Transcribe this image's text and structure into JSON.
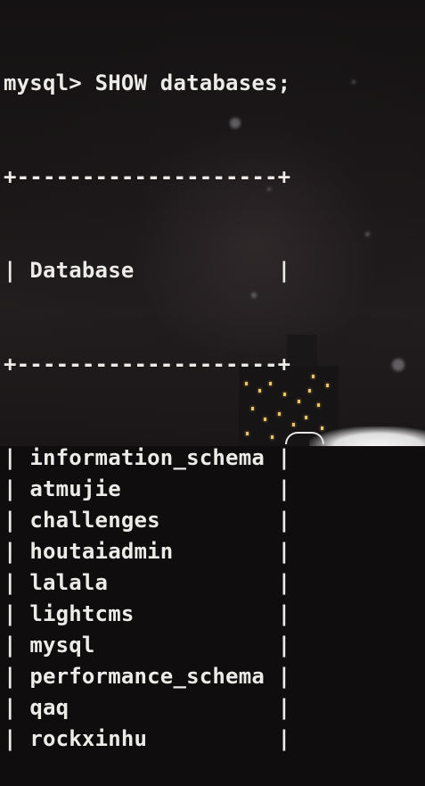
{
  "terminal": {
    "prompt": "mysql>",
    "command": "SHOW databases;",
    "border_top": "+--------------------+",
    "border_mid": "+--------------------+",
    "header": "Database",
    "rows": [
      "information_schema",
      "atmujie",
      "challenges",
      "houtaiadmin",
      "lalala",
      "lightcms",
      "mysql",
      "performance_schema",
      "qaq",
      "rockxinhu"
    ]
  },
  "colors": {
    "text": "#ecebe8",
    "background": "#0f0d0e",
    "window_light": "#e8c46a"
  }
}
